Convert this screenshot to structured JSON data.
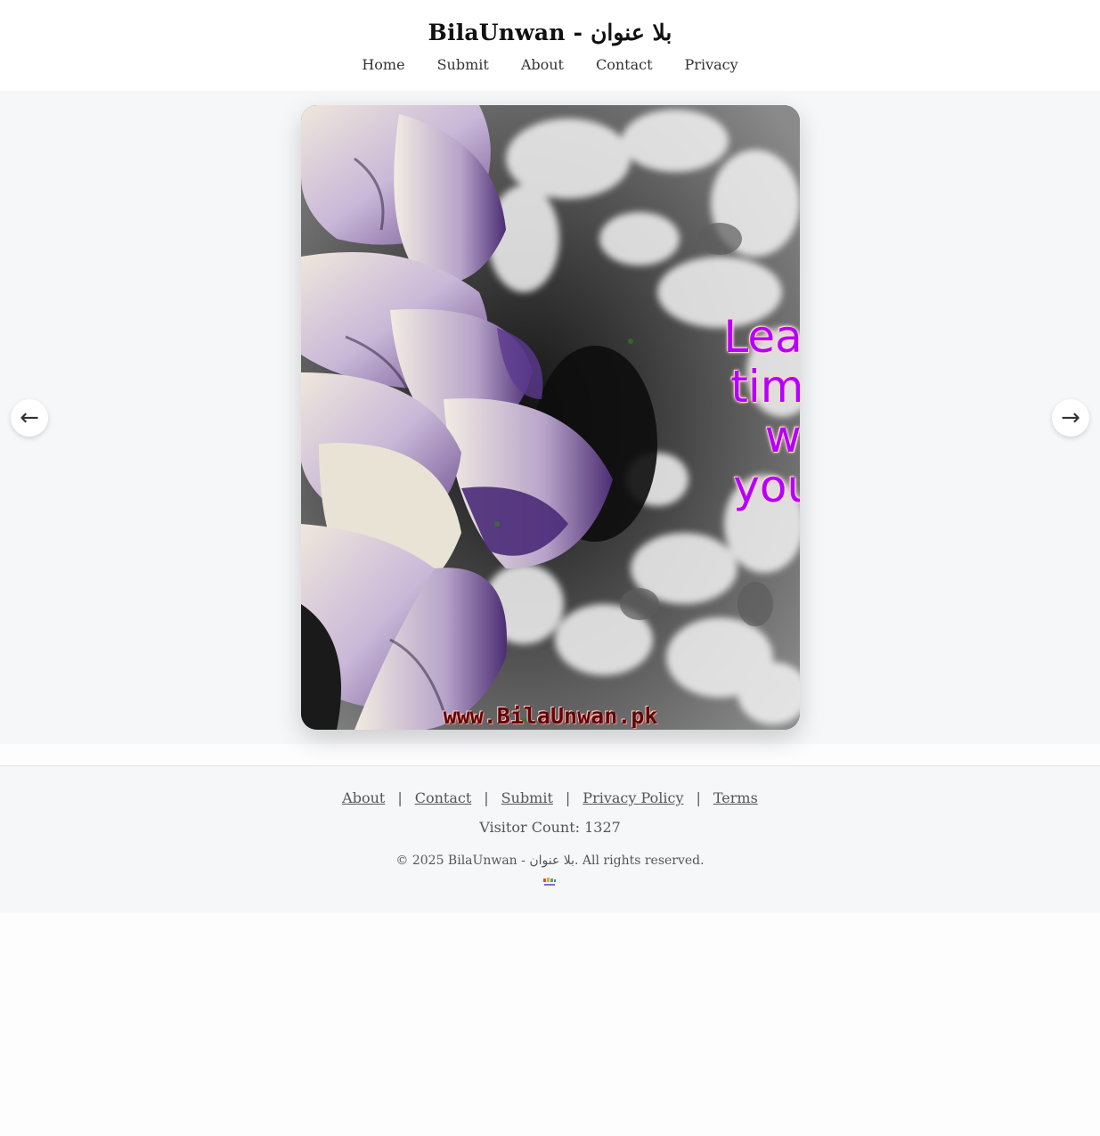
{
  "site": {
    "title": "BilaUnwan - بلا عنوان"
  },
  "nav": {
    "items": [
      "Home",
      "Submit",
      "About",
      "Contact",
      "Privacy"
    ]
  },
  "slider": {
    "quote_lines": [
      "Learn t",
      "time a",
      "will",
      "you st"
    ],
    "watermark": "www.BilaUnwan.pk",
    "prev_icon": "←",
    "next_icon": "→"
  },
  "footer": {
    "links": [
      "About",
      "Contact",
      "Submit",
      "Privacy Policy",
      "Terms"
    ],
    "separator": "|",
    "visitor_count": "Visitor Count: 1327",
    "copyright": "© 2025 BilaUnwan - بلا عنوان. All rights reserved."
  },
  "colors": {
    "quote_text": "#b300ff",
    "page_background": "#f6f7f9"
  }
}
